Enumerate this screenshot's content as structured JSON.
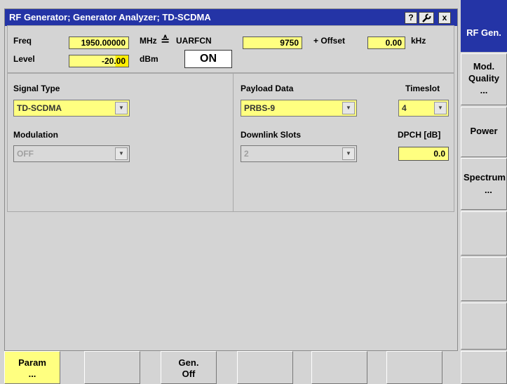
{
  "window": {
    "title": "RF Generator; Generator Analyzer; TD-SCDMA",
    "help_label": "?",
    "close_label": "x"
  },
  "top": {
    "freq_label": "Freq",
    "freq_value": "1950.00000",
    "freq_unit": "MHz",
    "link_symbol": "≙",
    "uarfcn_label": "UARFCN",
    "uarfcn_value": "9750",
    "offset_label": "+ Offset",
    "offset_value": "0.00",
    "offset_unit": "kHz",
    "level_label": "Level",
    "level_value": "-20.00",
    "level_unit": "dBm",
    "on_label": "ON"
  },
  "signal": {
    "type_label": "Signal Type",
    "type_value": "TD-SCDMA",
    "modulation_label": "Modulation",
    "modulation_value": "OFF"
  },
  "payload": {
    "label": "Payload Data",
    "value": "PRBS-9",
    "timeslot_label": "Timeslot",
    "timeslot_value": "4",
    "downlink_label": "Downlink Slots",
    "downlink_value": "2",
    "dpch_label": "DPCH [dB]",
    "dpch_value": "0.0"
  },
  "sidebar": {
    "rf_gen": "RF Gen.",
    "mod_quality_1": "Mod.",
    "mod_quality_2": "Quality",
    "mod_quality_3": "...",
    "power": "Power",
    "spectrum_1": "Spectrum",
    "spectrum_2": "..."
  },
  "bottom": {
    "param_1": "Param",
    "param_2": "...",
    "genoff_1": "Gen.",
    "genoff_2": "Off"
  },
  "colors": {
    "titlebar": "#2434a6",
    "field_yellow": "#ffff80",
    "background": "#d4d4d4"
  }
}
